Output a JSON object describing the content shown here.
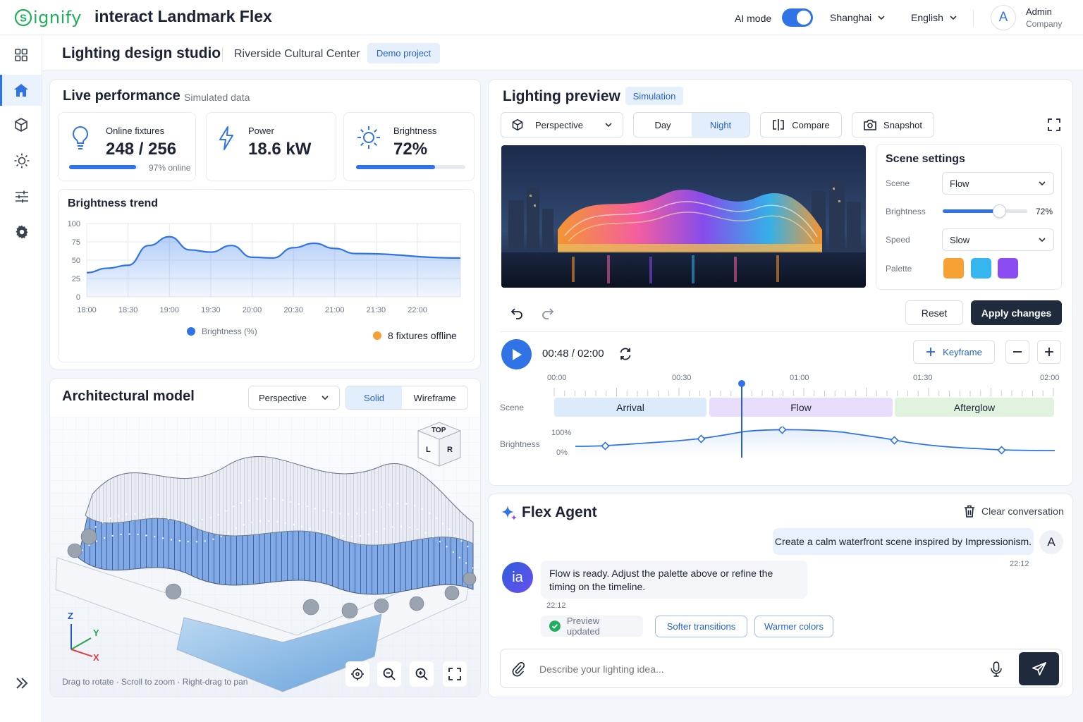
{
  "topbar": {
    "brand": "ignify",
    "app_title": "interact Landmark Flex",
    "ai_mode_label": "AI mode",
    "location": "Shanghai",
    "language": "English",
    "user_initial": "A",
    "user_name": "Admin",
    "user_org": "Company"
  },
  "subheader": {
    "title": "Lighting design studio",
    "project": "Riverside Cultural Center",
    "badge": "Demo project"
  },
  "live": {
    "title": "Live performance",
    "subtitle": "Simulated data",
    "fixtures": {
      "label": "Online fixtures",
      "value": "248 / 256",
      "note": "97% online",
      "progress": 0.97
    },
    "power": {
      "label": "Power",
      "value": "18.6 kW"
    },
    "brightness": {
      "label": "Brightness",
      "value": "72%",
      "progress": 0.72
    },
    "trend": {
      "title": "Brightness trend",
      "legend": "Brightness (%)",
      "offline": "8 fixtures offline"
    }
  },
  "chart_data": {
    "type": "area",
    "title": "Brightness trend",
    "x": [
      "18:00",
      "18:30",
      "19:00",
      "19:30",
      "20:00",
      "20:30",
      "21:00",
      "21:30",
      "22:00"
    ],
    "series": [
      {
        "name": "Brightness (%)",
        "values": [
          33,
          39,
          43,
          70,
          82,
          64,
          61,
          70,
          54,
          53,
          67,
          73,
          66,
          59,
          53
        ]
      }
    ],
    "series_x": [
      0,
      0.5,
      1,
      1.5,
      2,
      2.5,
      3,
      3.5,
      4,
      4.5,
      5,
      5.5,
      6,
      6.5,
      7
    ],
    "yticks": [
      0,
      25,
      50,
      75,
      100
    ],
    "ylim": [
      0,
      100
    ],
    "grid": true,
    "legend_position": "bottom"
  },
  "model": {
    "title": "Architectural model",
    "view": "Perspective",
    "solid": "Solid",
    "wireframe": "Wireframe",
    "cube_top": "TOP",
    "cube_l": "L",
    "cube_r": "R",
    "axis_x": "X",
    "axis_y": "Y",
    "axis_z": "Z",
    "hint": "Drag to rotate · Scroll to zoom · Right-drag to pan"
  },
  "preview": {
    "title": "Lighting preview",
    "badge": "Simulation",
    "view": "Perspective",
    "day": "Day",
    "night": "Night",
    "compare": "Compare",
    "snapshot": "Snapshot"
  },
  "scene": {
    "title": "Scene settings",
    "scene_label": "Scene",
    "scene_value": "Flow",
    "brightness_label": "Brightness",
    "brightness_value": "72%",
    "brightness_level": 0.72,
    "speed_label": "Speed",
    "speed_value": "Slow",
    "palette_label": "Palette",
    "palette": [
      "#f7a034",
      "#35b6ef",
      "#8b4cf2"
    ],
    "reset": "Reset",
    "apply": "Apply changes"
  },
  "timeline": {
    "time": "00:48 / 02:00",
    "keyframe": "Keyframe",
    "ticks": [
      "00:00",
      "00:30",
      "01:00",
      "01:30",
      "02:00"
    ],
    "scene_label": "Scene",
    "brightness_label": "Brightness",
    "b100": "100%",
    "b0": "0%",
    "segments": [
      {
        "name": "Arrival",
        "color": "#dcebfb"
      },
      {
        "name": "Flow",
        "color": "#e8ddfb"
      },
      {
        "name": "Afterglow",
        "color": "#dff3de"
      }
    ]
  },
  "agent": {
    "title": "Flex Agent",
    "clear": "Clear conversation",
    "user_msg": "Create a calm waterfront scene inspired by Impressionism.",
    "user_time": "22:12",
    "user_initial": "A",
    "bot_avatar": "ia",
    "bot_msg": "Flow is ready. Adjust the palette above or refine the timing on the timeline.",
    "bot_time": "22:12",
    "status": "Preview updated",
    "chip1": "Softer transitions",
    "chip2": "Warmer colors",
    "input_placeholder": "Describe your lighting idea..."
  }
}
